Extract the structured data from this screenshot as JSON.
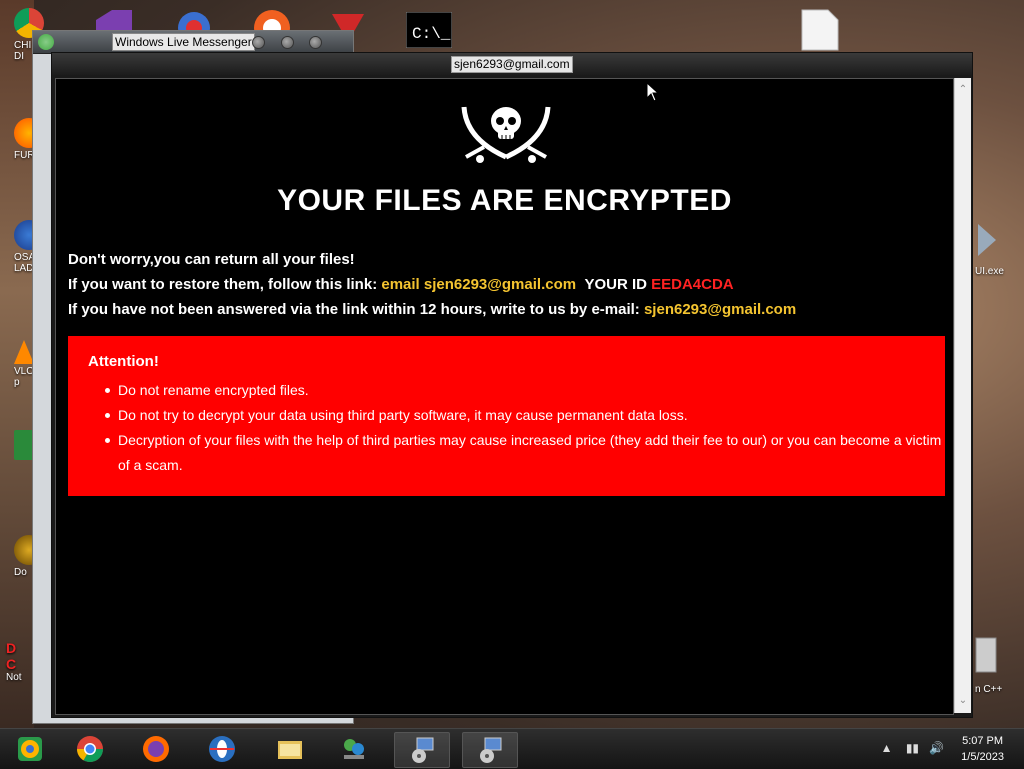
{
  "desktop": {
    "left_labels": [
      "CHI",
      "DI",
      "FURR",
      "OSA",
      "LAD",
      "VLC",
      "p",
      "Do",
      "D",
      "C",
      "Not"
    ],
    "right_labels": [
      "UI.exe",
      "n C++"
    ]
  },
  "back_window": {
    "title": "Windows Live Messenger"
  },
  "main_window": {
    "title": "sjen6293@gmail.com",
    "headline": "YOUR FILES ARE ENCRYPTED",
    "line1": "Don't worry,you can return all your files!",
    "line2_prefix": "If you want to restore them, follow this link:",
    "line2_link": "email sjen6293@gmail.com",
    "line2_id_label": "YOUR ID",
    "line2_id": "EEDA4CDA",
    "line3_prefix": "If you have not been answered via the link within 12 hours, write to us by e-mail:",
    "line3_email": "sjen6293@gmail.com",
    "attention": {
      "title": "Attention!",
      "items": [
        "Do not rename encrypted files.",
        "Do not try to decrypt your data using third party software, it may cause permanent data loss.",
        "Decryption of your files with the help of third parties may cause increased price (they add their fee to our) or you can become a victim of a scam."
      ]
    }
  },
  "taskbar": {
    "buttons": [
      "chrome-canary-icon",
      "chrome-icon",
      "firefox-icon",
      "opera-icon",
      "file-explorer-icon",
      "network-icon",
      "setup-icon",
      "setup-icon"
    ],
    "time": "5:07 PM",
    "date": "1/5/2023"
  },
  "colors": {
    "highlight_yellow": "#f4c430",
    "id_red": "#ff2222",
    "attention_bg": "#ff0000"
  }
}
